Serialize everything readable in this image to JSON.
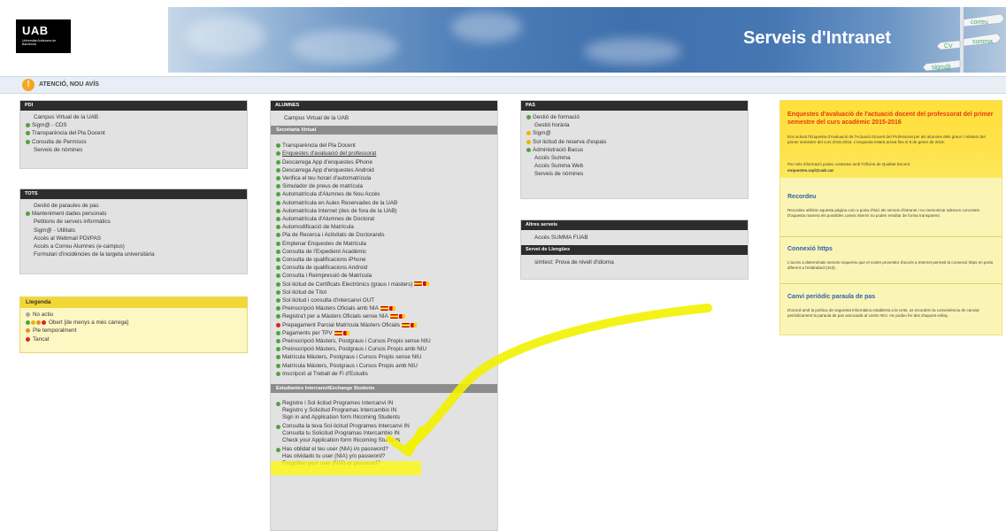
{
  "logo": {
    "text": "UAB",
    "subtext": "Universitat Autònoma de Barcelona"
  },
  "banner": {
    "title": "Serveis d'Intranet",
    "signs": [
      "CV",
      "summa",
      "sigm@",
      "correu"
    ]
  },
  "notice": {
    "text": "ATENCIÓ, NOU AVÍS"
  },
  "pdi": {
    "title": "PDI",
    "items": [
      {
        "label": "Campus Virtual de la UAB",
        "status": "none"
      },
      {
        "label": "Sigm@ - CDS",
        "status": "green"
      },
      {
        "label": "Transparència del Pla Docent",
        "status": "green"
      },
      {
        "label": "Consulta de Permisos",
        "status": "green"
      },
      {
        "label": "Serveis de nòmines",
        "status": "none"
      }
    ]
  },
  "tots": {
    "title": "TOTS",
    "items": [
      {
        "label": "Gestió de paraules de pas",
        "status": "none"
      },
      {
        "label": "Manteniment dades personals",
        "status": "green"
      },
      {
        "label": "Petitions de serveis informàtics",
        "status": "none"
      },
      {
        "label": "Sigm@ - Utilitats",
        "status": "none"
      },
      {
        "label": "Accés al Webmail PDI/PAS",
        "status": "none"
      },
      {
        "label": "Accés a Correu Alumnes (e-campus)",
        "status": "none"
      },
      {
        "label": "Formulari d'incidències de la targeta universitària",
        "status": "none"
      }
    ]
  },
  "legend": {
    "title": "Llegenda",
    "items": [
      {
        "label": "No actiu",
        "dots": [
          "gray"
        ]
      },
      {
        "label": "Obert [de menys a més càrrega]",
        "dots": [
          "green",
          "yellow",
          "orange",
          "red"
        ]
      },
      {
        "label": "Ple temporalment",
        "dots": [
          "orange"
        ]
      },
      {
        "label": "Tancat",
        "dots": [
          "red"
        ]
      }
    ]
  },
  "alumnes": {
    "title": "ALUMNES",
    "campus": "Campus Virtual de la UAB",
    "secretaria_title": "Secretaria Virtual",
    "items": [
      {
        "label": "Transparència del Pla Docent",
        "flag": false
      },
      {
        "label": "Enquestes d'avaluació del professorat",
        "flag": false,
        "underline": true
      },
      {
        "label": "Descarrega App d'enquestes iPhone",
        "flag": false
      },
      {
        "label": "Descarrega App d'enquestes Android",
        "flag": false
      },
      {
        "label": "Verifica el teu horari d'automatrícula",
        "flag": false
      },
      {
        "label": "Simulador de preus de matrícula",
        "flag": false
      },
      {
        "label": "Automatrícula d'Alumnes de Nou Accés",
        "flag": false
      },
      {
        "label": "Automatrícula en Aules Reservades de la UAB",
        "flag": false
      },
      {
        "label": "Automatrícula Internet (des de fora de la UAB)",
        "flag": false
      },
      {
        "label": "Automatrícula d'Alumnes de Doctorat",
        "flag": false
      },
      {
        "label": "Automodificació de Matrícula",
        "flag": false
      },
      {
        "label": "Pla de Recerca i Activitats de Doctorands",
        "flag": false
      },
      {
        "label": "Emplenar Enquestes de Matrícula",
        "flag": false
      },
      {
        "label": "Consulta de l'Expedient Acadèmic",
        "flag": false
      },
      {
        "label": "Consulta de qualificacions iPhone",
        "flag": false
      },
      {
        "label": "Consulta de qualificacions Android",
        "flag": false
      },
      {
        "label": "Consulta i Reimpressió de Matrícula",
        "flag": false
      },
      {
        "label": "Sol·licitud de Certificats Electrònics (graus i màsters)",
        "flag": true
      },
      {
        "label": "Sol·licitud de Títol",
        "flag": false
      },
      {
        "label": "Sol·licitud i consulta d'intercanvi OUT",
        "flag": false
      },
      {
        "label": "Preinscripció Màsters Oficials amb NIA",
        "flag": true
      },
      {
        "label": "Registra't per a Màsters Oficials sense NIA",
        "flag": true
      },
      {
        "label": "Prepagament Parcial Matrícula Màsters Oficials",
        "flag": true,
        "dot": "red"
      },
      {
        "label": "Pagaments per TPV",
        "flag": true
      },
      {
        "label": "Preinscripció Màsters, Postgraus i Cursos Propis sense NIU",
        "flag": false
      },
      {
        "label": "Preinscripció Màsters, Postgraus i Cursos Propis amb NIU",
        "flag": false
      },
      {
        "label": "Matrícula Màsters, Postgraus i Cursos Propis sense NIU",
        "flag": false
      },
      {
        "label": "Matrícula Màsters, Postgraus i Cursos Propis amb NIU",
        "flag": false
      },
      {
        "label": "Inscripció al Treball de Fi d'Estudis",
        "flag": false
      }
    ],
    "exchange_title": "Estudiantes Intercanvi/Exchange Students",
    "exchange": [
      {
        "lines": [
          "Registre i Sol·licitud Programes Intercanvi IN",
          "Registro y Solicitud Programas Intercambio IN",
          "Sign in and Application form INcoming Students"
        ]
      },
      {
        "lines": [
          "Consulta la teva Sol·licitud Programes Intercanvi IN",
          "Consulta tu Solicitud Programas Intercambio IN",
          "Check your Application form INcoming Students"
        ]
      },
      {
        "lines": [
          "Has oblidat el teu user (NIA) i/o password?",
          "Has olvidado tu user (NIA) y/o password?",
          "Forgotten your user (NIA) or password?"
        ]
      }
    ]
  },
  "pas": {
    "title": "PAS",
    "items": [
      {
        "label": "Gestió de formació",
        "status": "green"
      },
      {
        "label": "Gestió horària",
        "status": "none"
      },
      {
        "label": "Sigm@",
        "status": "yellow"
      },
      {
        "label": "Sol·licitud de reserva d'espais",
        "status": "yellow"
      },
      {
        "label": "Administració Bacus",
        "status": "green"
      },
      {
        "label": "Accés Summa",
        "status": "none"
      },
      {
        "label": "Accés Summa Web",
        "status": "none"
      },
      {
        "label": "Serveis de nòmines",
        "status": "none"
      }
    ]
  },
  "altres": {
    "title": "Altres serveis",
    "items": [
      {
        "label": "Accés SUMMA FUAB"
      }
    ],
    "llengues_title": "Servei de Llengües",
    "llengues_items": [
      {
        "label": "simtest: Prova de nivell d'idioma"
      }
    ]
  },
  "right": {
    "enquestes_title": "Enquestes d'avaluació de l'actuació docent del professorat del primer semestre del curs acadèmic 2015-2016",
    "enquestes_text1": "Ens activat l'Enquesta d'Avaluació de l'Actuació Docent del Professorat per als alumnes dels graus i màsters del primer semestre del curs 2015-2016. L'enquesta estarà activa fins el 8 de gener de 2016.",
    "enquestes_text2": "Per més informació podeu contactar amb l'Oficina de Qualitat Docent:",
    "enquestes_email": "enquestes.oqd@uab.cat",
    "recordeu_title": "Recordeu",
    "recordeu_text": "Recordeu utilitzar aquesta pàgina com a porta d'inici als serveis d'intranet i no memoritzar adreces concretes. D'aquesta manera els possibles canvis interns no poden resultar de forma transparent.",
    "https_title": "Connexió https",
    "https_text": "L'accés a determinats serveis requereix que el vostre proveïdor d'accés a Internet permeti la connexió https en porta diferent a l'estàndard (443).",
    "canvi_title": "Canvi periòdic paraula de pas",
    "canvi_text": "D'acord amb la política de seguretat informàtica establerta a la UAB, us recordem la conveniència de canviar periòdicament la paraula de pas associada al vostre NIU. Ho podeu fer des d'aquest enllaç."
  }
}
